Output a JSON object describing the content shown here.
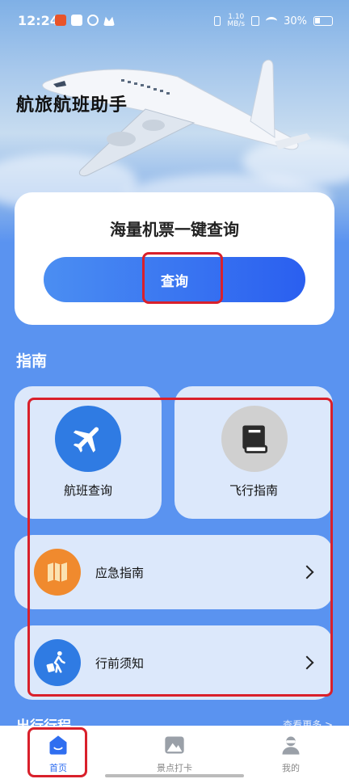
{
  "status_bar": {
    "time": "12:24",
    "net_speed_value": "1.10",
    "net_speed_unit": "MB/s",
    "battery": "30%"
  },
  "app": {
    "title": "航旅航班助手"
  },
  "search_card": {
    "title": "海量机票一键查询",
    "button_label": "查询"
  },
  "guide": {
    "section_title": "指南",
    "tiles": [
      {
        "label": "航班查询",
        "icon": "airplane-icon",
        "color": "#2f7be3"
      },
      {
        "label": "飞行指南",
        "icon": "book-icon",
        "color": "#d0d0d0"
      }
    ],
    "rows": [
      {
        "label": "应急指南",
        "icon": "map-icon",
        "color": "#f08a2e"
      },
      {
        "label": "行前须知",
        "icon": "traveler-icon",
        "color": "#2f7be3"
      }
    ]
  },
  "trips": {
    "title": "出行行程",
    "more": "查看更多 >"
  },
  "tabbar": {
    "tabs": [
      {
        "label": "首页",
        "icon": "home-icon",
        "active": true
      },
      {
        "label": "景点打卡",
        "icon": "mountain-icon",
        "active": false
      },
      {
        "label": "我的",
        "icon": "profile-icon",
        "active": false
      }
    ]
  },
  "colors": {
    "background": "#5a93f0",
    "accent": "#2f6ef0",
    "highlight": "#d9202b"
  }
}
